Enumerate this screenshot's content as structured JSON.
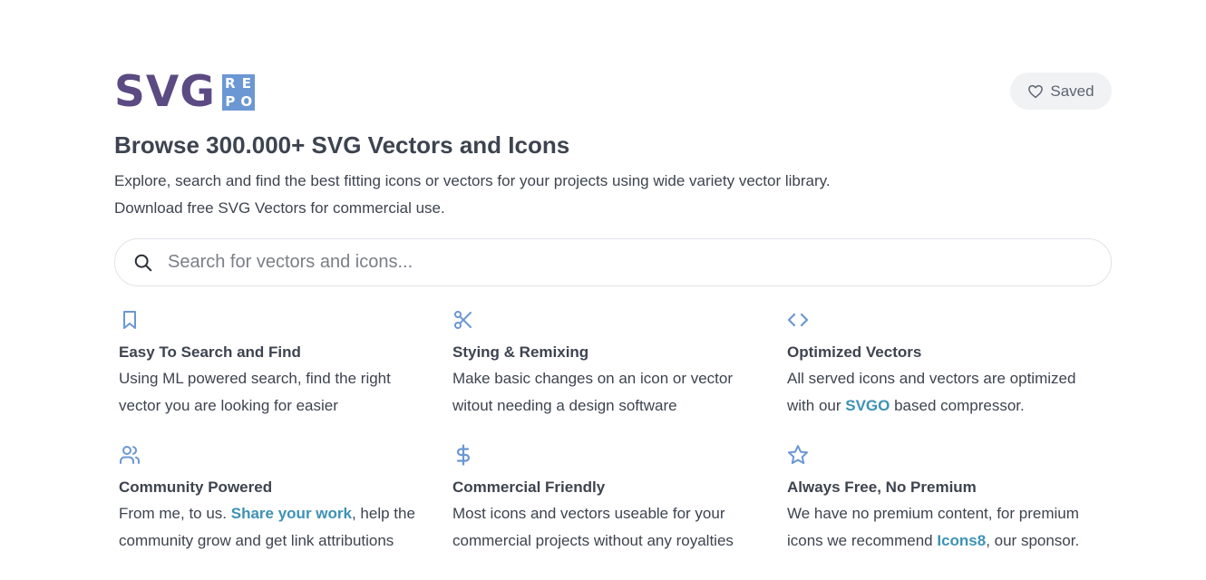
{
  "logo": {
    "main": "SVG",
    "tag": [
      "R",
      "E",
      "P",
      "O"
    ]
  },
  "header": {
    "saved_label": "Saved"
  },
  "hero": {
    "title": "Browse 300.000+ SVG Vectors and Icons",
    "desc_line1": "Explore, search and find the best fitting icons or vectors for your projects using wide variety vector library.",
    "desc_line2": "Download free SVG Vectors for commercial use."
  },
  "search": {
    "placeholder": "Search for vectors and icons..."
  },
  "features": [
    {
      "icon": "bookmark-icon",
      "title": "Easy To Search and Find",
      "line1": "Using ML powered search, find the right",
      "line2": "vector you are looking for easier"
    },
    {
      "icon": "scissors-icon",
      "title": "Stying & Remixing",
      "line1": "Make basic changes on an icon or vector",
      "line2": "witout needing a design software"
    },
    {
      "icon": "code-icon",
      "title": "Optimized Vectors",
      "line1": "All served icons and vectors are optimized",
      "line2_pre": "with our ",
      "link": "SVGO",
      "line2_post": " based compressor."
    },
    {
      "icon": "users-icon",
      "title": "Community Powered",
      "line1_pre": "From me, to us. ",
      "link": "Share your work",
      "line1_post": ", help the",
      "line2": "community grow and get link attributions"
    },
    {
      "icon": "dollar-icon",
      "title": "Commercial Friendly",
      "line1": "Most icons and vectors useable for your",
      "line2": "commercial projects without any royalties"
    },
    {
      "icon": "star-icon",
      "title": "Always Free, No Premium",
      "line1": "We have no premium content, for premium",
      "line2_pre": "icons we recommend ",
      "link": "Icons8",
      "line2_post": ", our sponsor."
    }
  ],
  "colors": {
    "logo_purple": "#5b4b82",
    "logo_blue": "#6b97d3",
    "icon_blue": "#6b97d3",
    "link": "#3e92b5",
    "text": "#3d4450"
  }
}
